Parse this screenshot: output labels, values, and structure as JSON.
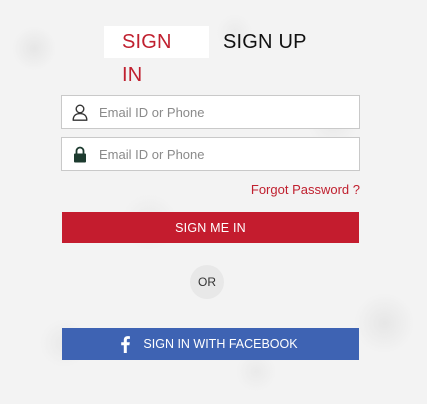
{
  "tabs": {
    "sign_in": "SIGN IN",
    "sign_up": "SIGN UP"
  },
  "form": {
    "email_placeholder": "Email ID or Phone",
    "password_placeholder": "Email ID or Phone",
    "email_icon": "user-icon",
    "password_icon": "lock-icon",
    "forgot_password": "Forgot Password ?",
    "sign_in_button": "SIGN ME IN",
    "divider": "OR",
    "facebook_button": "SIGN IN WITH FACEBOOK",
    "facebook_icon": "facebook-icon"
  },
  "colors": {
    "accent_red": "#c41c2e",
    "facebook_blue": "#3e63b3"
  }
}
